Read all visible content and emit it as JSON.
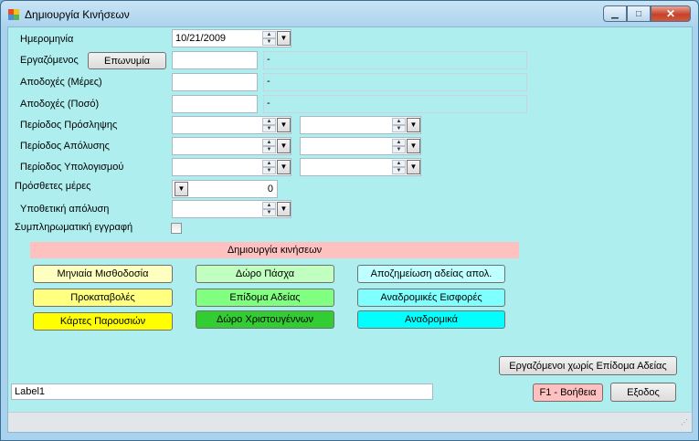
{
  "window": {
    "title": "Δημιουργία Κινήσεων",
    "minimize_glyph": "▁",
    "maximize_glyph": "□",
    "close_glyph": "✕"
  },
  "form": {
    "date_label": "Ημερομηνία",
    "date_value": "10/21/2009",
    "employee_label": "Εργαζόμενος",
    "employee_button": "Επωνυμία",
    "employee_value": "",
    "employee_name": "-",
    "days_label": "Αποδοχές (Μέρες)",
    "days_value": "",
    "days_desc": "-",
    "amount_label": "Αποδοχές (Ποσό)",
    "amount_value": "",
    "amount_desc": "-",
    "hire_period_label": "Περίοδος Πρόσληψης",
    "dismissal_period_label": "Περίοδος Απόλυσης",
    "calc_period_label": "Περίοδος Υπολογισμού",
    "extra_days_label": "Πρόσθετες μέρες",
    "extra_days_value": "0",
    "hypothetical_label": "Υποθετική απόλυση",
    "supplementary_label": "Συμπληρωματική εγγραφή"
  },
  "banner": {
    "label": "Δημιουργία κινήσεων"
  },
  "buttons": {
    "monthly": "Μηνιαία Μισθοδοσία",
    "easter": "Δώρο Πάσχα",
    "leave_comp": "Αποζημείωση αδείας απολ.",
    "advances": "Προκαταβολές",
    "leave_allowance": "Επίδομα Αδείας",
    "retro_contrib": "Αναδρομικές Εισφορές",
    "attendance": "Κάρτες Παρουσιών",
    "christmas": "Δώρο Χριστουγέννων",
    "retro": "Αναδρομικά",
    "no_allowance": "Εργαζόμενοι χωρίς Επίδομα Αδείας",
    "help": "F1 - Βοήθεια",
    "exit": "Εξοδος"
  },
  "status": {
    "label1": "Label1"
  },
  "colors": {
    "client_bg": "#aeeeee",
    "banner": "#ffc0c0",
    "yellow_light": "#ffffc0",
    "yellow": "#ffff80",
    "yellow_strong": "#ffff00",
    "green_light": "#c0ffc0",
    "green": "#80ff80",
    "green_strong": "#32cd32",
    "cyan_light": "#c0ffff",
    "cyan": "#80ffff",
    "cyan_strong": "#00ffff",
    "help_pink": "#ffc0c0"
  },
  "icons": {
    "spin": "spin-updown-icon",
    "dropdown": "dropdown-arrow-icon",
    "app": "app-form-icon",
    "grip": "resize-grip-icon"
  }
}
